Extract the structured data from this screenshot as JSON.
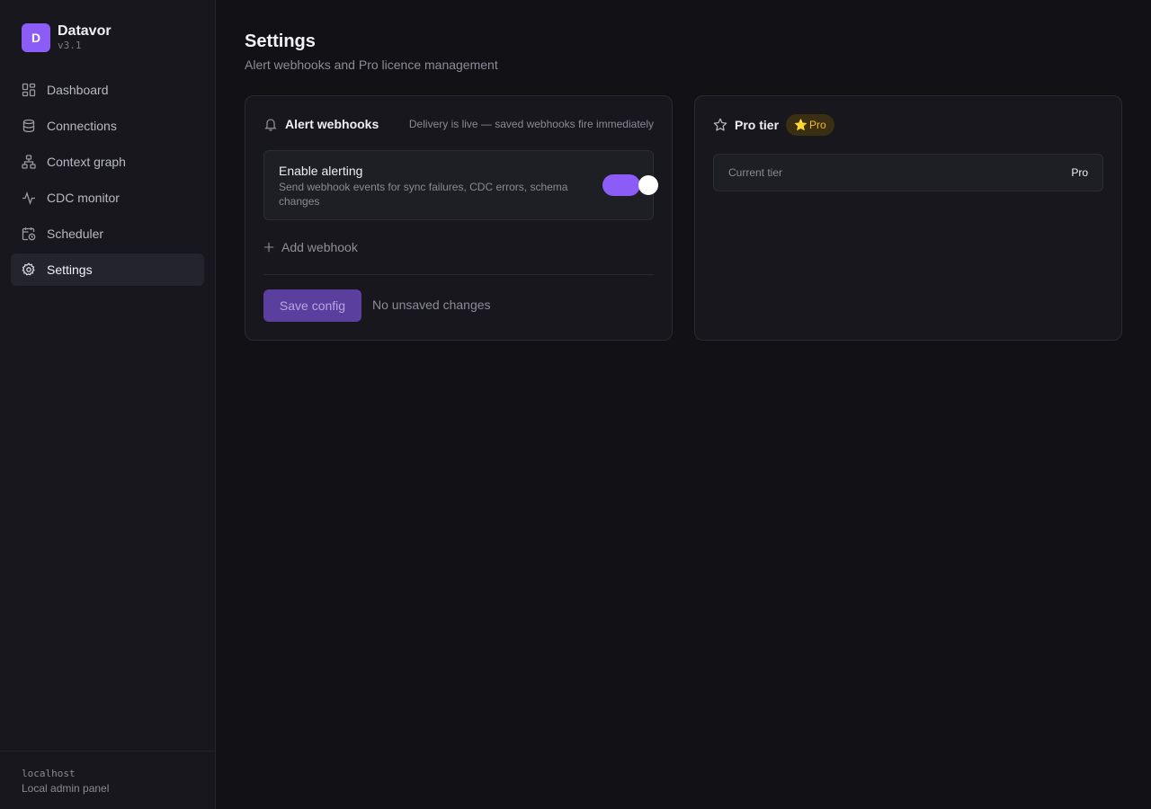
{
  "app": {
    "logo_letter": "D",
    "name": "Datavor",
    "version": "v3.1"
  },
  "nav": {
    "items": [
      {
        "label": "Dashboard",
        "icon": "dashboard-icon"
      },
      {
        "label": "Connections",
        "icon": "database-icon"
      },
      {
        "label": "Context graph",
        "icon": "graph-icon"
      },
      {
        "label": "CDC monitor",
        "icon": "activity-icon"
      },
      {
        "label": "Scheduler",
        "icon": "calendar-clock-icon"
      },
      {
        "label": "Settings",
        "icon": "gear-icon",
        "active": true
      }
    ]
  },
  "footer": {
    "host": "localhost",
    "description": "Local admin panel"
  },
  "page": {
    "title": "Settings",
    "subtitle": "Alert webhooks and Pro licence management"
  },
  "webhooks": {
    "title": "Alert webhooks",
    "note": "Delivery is live — saved webhooks fire immediately",
    "toggle_title": "Enable alerting",
    "toggle_desc": "Send webhook events for sync failures, CDC errors, schema changes",
    "toggle_on": true,
    "add_label": "Add webhook",
    "save_label": "Save config",
    "save_status": "No unsaved changes"
  },
  "pro": {
    "title": "Pro tier",
    "badge_star": "⭐",
    "badge": "Pro",
    "tier_label": "Current tier",
    "tier_value": "Pro"
  },
  "colors": {
    "accent": "#8b5cf6",
    "background": "#111116",
    "badge_text": "#f2b632"
  }
}
